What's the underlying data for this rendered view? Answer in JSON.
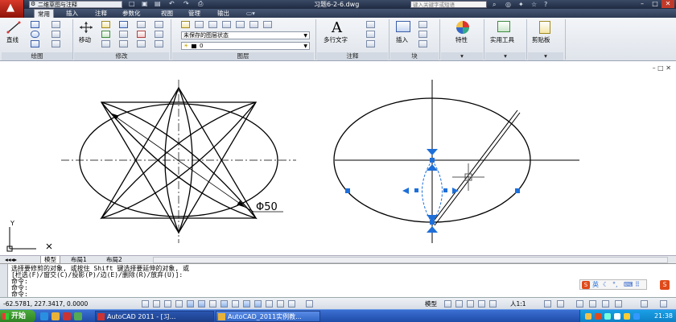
{
  "window": {
    "workspace": "二维草图与注释",
    "document_title": "习题6-2-6.dwg",
    "search_placeholder": "键入关键字或短语"
  },
  "ribbon_tabs": [
    {
      "label": "常用",
      "active": true
    },
    {
      "label": "插入",
      "active": false
    },
    {
      "label": "注释",
      "active": false
    },
    {
      "label": "参数化",
      "active": false
    },
    {
      "label": "视图",
      "active": false
    },
    {
      "label": "管理",
      "active": false
    },
    {
      "label": "输出",
      "active": false
    }
  ],
  "ribbon": {
    "line_label": "直线",
    "move_label": "移动",
    "layer_state": "未保存的图层状态",
    "layer_current": "0",
    "mtext_label": "多行文字",
    "insert_label": "插入",
    "properties_label": "特性",
    "utilities_label": "实用工具",
    "clipboard_label": "剪贴板",
    "panels": {
      "draw": "绘图",
      "modify": "修改",
      "layers": "图层",
      "annotation": "注释",
      "block": "块"
    }
  },
  "drawing": {
    "dimension_text": "Φ50",
    "ucs_x": "X",
    "ucs_y": "Y"
  },
  "layout_tabs": [
    {
      "label": "模型",
      "active": true
    },
    {
      "label": "布局1",
      "active": false
    },
    {
      "label": "布局2",
      "active": false
    }
  ],
  "command": {
    "lines": [
      "选择要修剪的对象, 或按住 Shift 键选择要延伸的对象, 或",
      "[栏选(F)/窗交(C)/投影(P)/边(E)/删除(R)/放弃(U)]:",
      "命令:",
      "命令:",
      "命令:"
    ]
  },
  "ime": {
    "lang": "英"
  },
  "status": {
    "coords": "-62.5781, 227.3417, 0.0000",
    "model_label": "模型",
    "annotation_scale": "人1:1"
  },
  "taskbar": {
    "start": "开始",
    "tasks": [
      {
        "label": "AutoCAD 2011 - [习...",
        "active": true
      },
      {
        "label": "AutoCAD_2011实例教...",
        "active": false
      }
    ],
    "clock": "21:38"
  },
  "colors": {
    "title_bar": "#1f2a40",
    "grip": "#1e6fd9",
    "taskbar": "#245edb"
  }
}
